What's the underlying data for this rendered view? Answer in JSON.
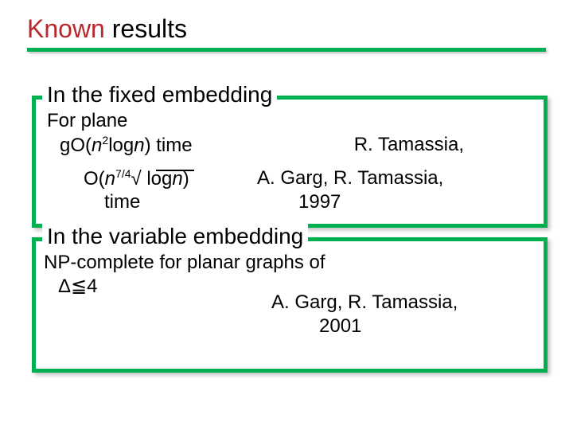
{
  "title": {
    "word1": "Known",
    "word2": "results"
  },
  "section1": {
    "heading": "In the fixed embedding",
    "line1": "For plane",
    "line2_pre": "g",
    "line2_o": "O(",
    "line2_n": "n",
    "line2_sup": "2",
    "line2_log": "log",
    "line2_n2": "n",
    "line2_end": ") time",
    "ref1": "R. Tamassia,",
    "line3_o": "O(",
    "line3_n": "n",
    "line3_sup": "7/4",
    "line3_sqrt": "√",
    "line3_space": " ",
    "line3_log": "log",
    "line3_n2": "n",
    "line3_end": ")",
    "line4": "time",
    "ref2a": "A. Garg, R. Tamassia,",
    "ref2b": "1997"
  },
  "section2": {
    "heading": "In the variable embedding",
    "line1": "NP-complete for planar graphs of",
    "line2": "Δ≦4",
    "refa": "A. Garg, R. Tamassia,",
    "refb": "2001"
  }
}
